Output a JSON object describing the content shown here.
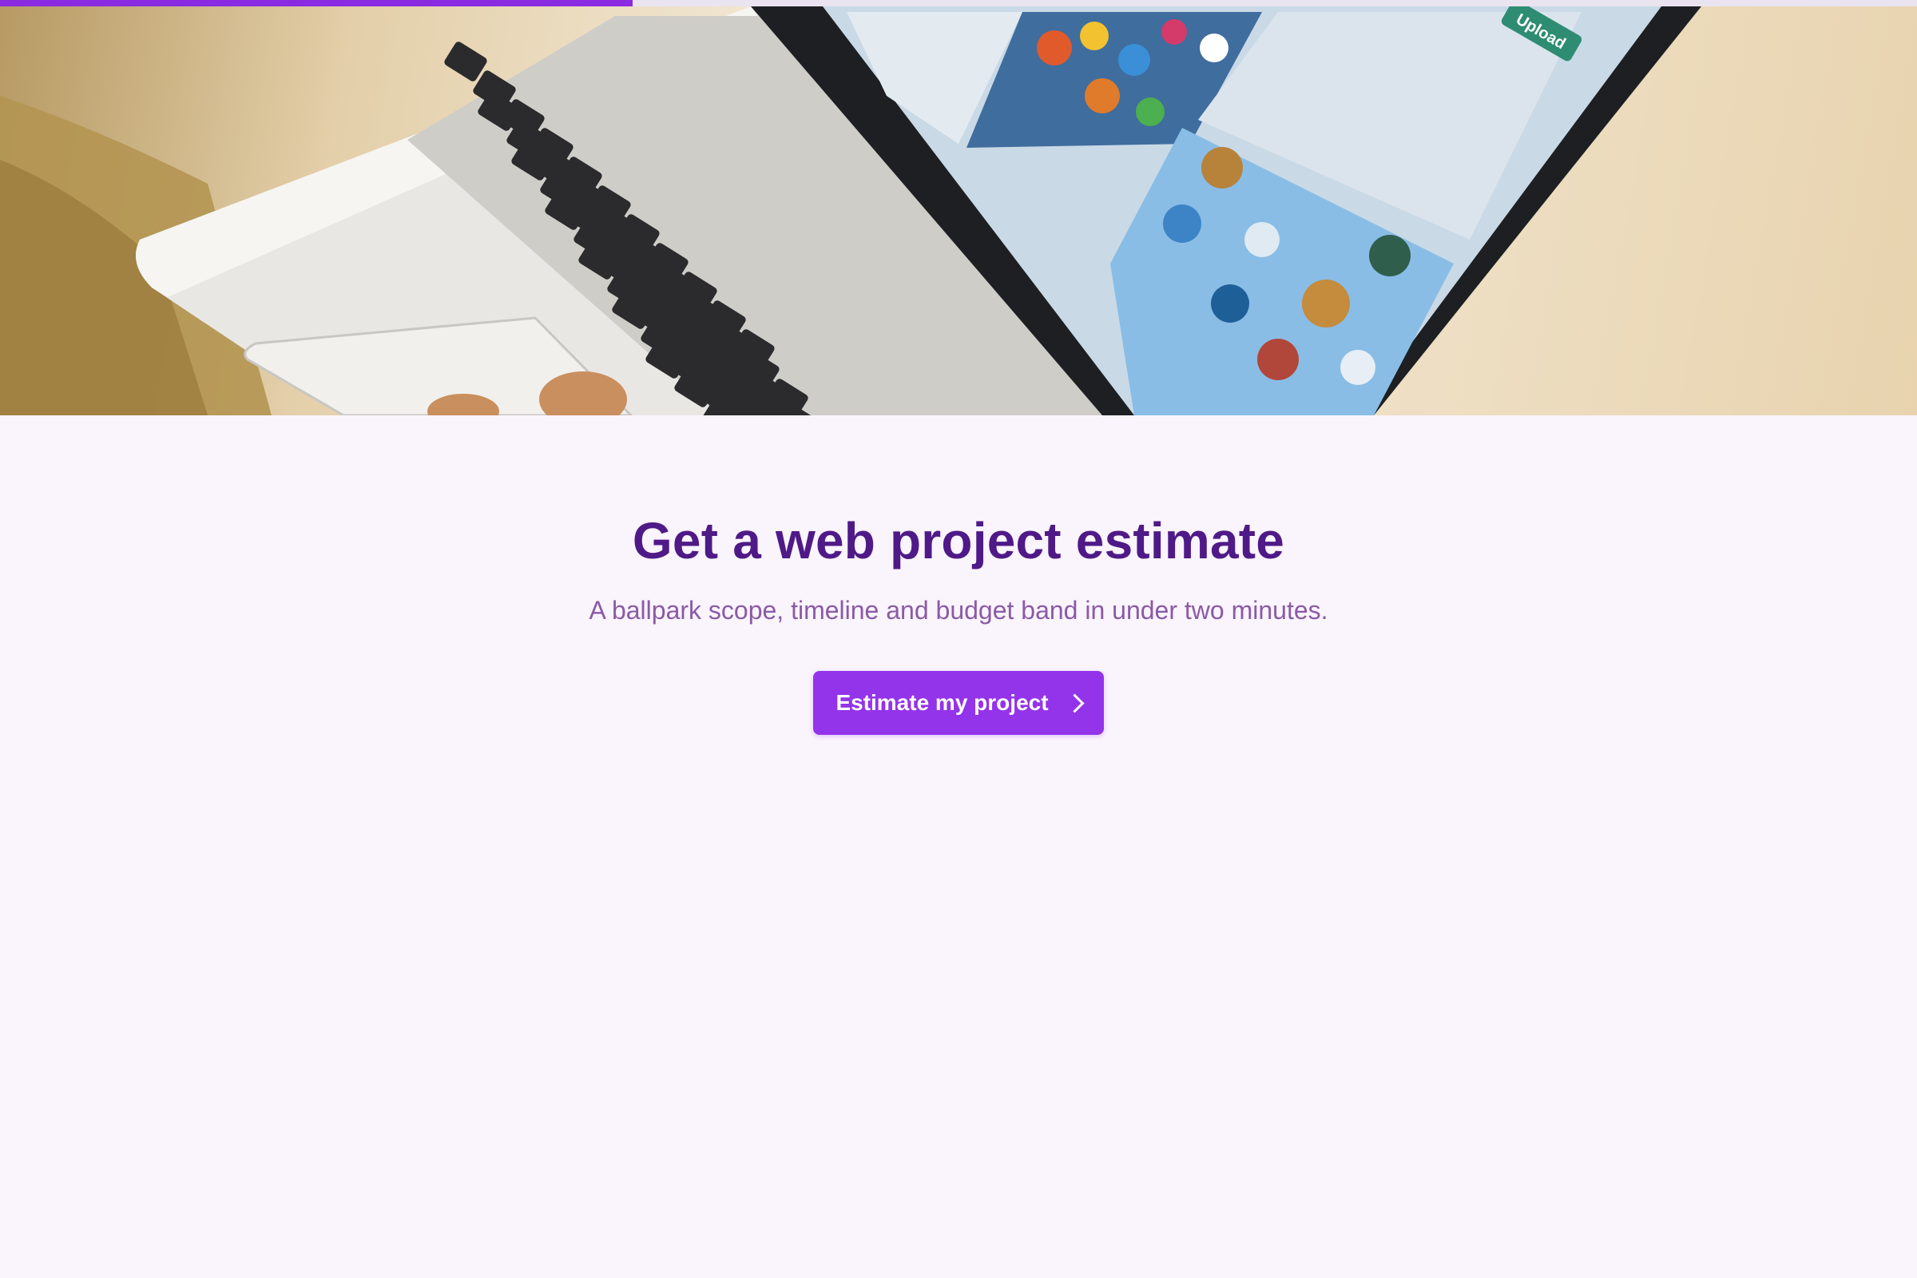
{
  "progress": {
    "fraction": 0.33,
    "color": "#8a2be2"
  },
  "hero": {
    "image": "laptop-keyboard-photo",
    "screen_badge": "Upload"
  },
  "main": {
    "title": "Get a web project estimate",
    "subtitle": "A ballpark scope, timeline and budget band in under two minutes.",
    "cta_label": "Estimate my project",
    "cta_icon": "chevron-right-icon"
  },
  "colors": {
    "background": "#faf4fd",
    "title": "#4f1a87",
    "subtitle": "#8a5aa6",
    "accent": "#9333ea"
  }
}
